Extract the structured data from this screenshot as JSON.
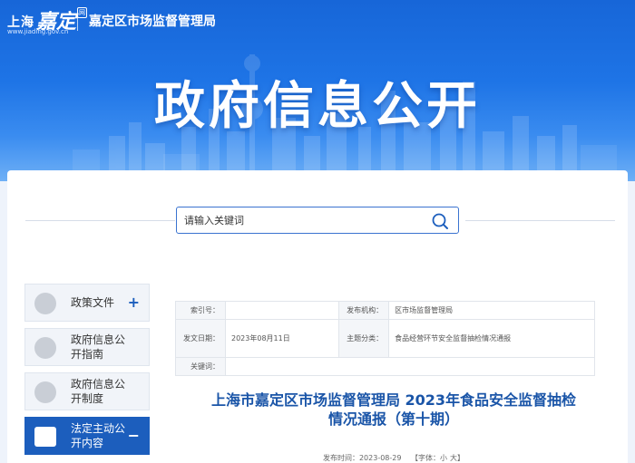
{
  "header": {
    "logo_text": "上海",
    "logo_script": "嘉定",
    "logo_sup": "网",
    "logo_url": "www.jiading.gov.cn",
    "agency": "嘉定区市场监督管理局",
    "banner_title": "政府信息公开"
  },
  "search": {
    "placeholder": "请输入关键词"
  },
  "sidebar": {
    "items": [
      {
        "label": "政策文件",
        "sign": "+",
        "active": false
      },
      {
        "label": "政府信息公开指南",
        "sign": "",
        "active": false
      },
      {
        "label": "政府信息公开制度",
        "sign": "",
        "active": false
      },
      {
        "label": "法定主动公开内容",
        "sign": "−",
        "active": true
      }
    ]
  },
  "meta": {
    "index_label": "索引号：",
    "index_value": "",
    "publisher_label": "发布机构：",
    "publisher_value": "区市场监督管理局",
    "doc_date_label": "发文日期：",
    "doc_date_value": "2023年08月11日",
    "category_label": "主题分类：",
    "category_value": "食品经营环节安全监督抽检情况通报",
    "keywords_label": "关键词：",
    "keywords_value": ""
  },
  "document": {
    "title_line1": "上海市嘉定区市场监督管理局 2023年食品安全监督抽检",
    "title_line2": "情况通报（第十期）",
    "publish_time": "发布时间：2023-08-29",
    "font_label": "【字体：",
    "font_small": "小",
    "font_large": "大】"
  },
  "colors": {
    "banner": "#1e74e6",
    "accent": "#1c5ebd",
    "title": "#1a55a8"
  }
}
